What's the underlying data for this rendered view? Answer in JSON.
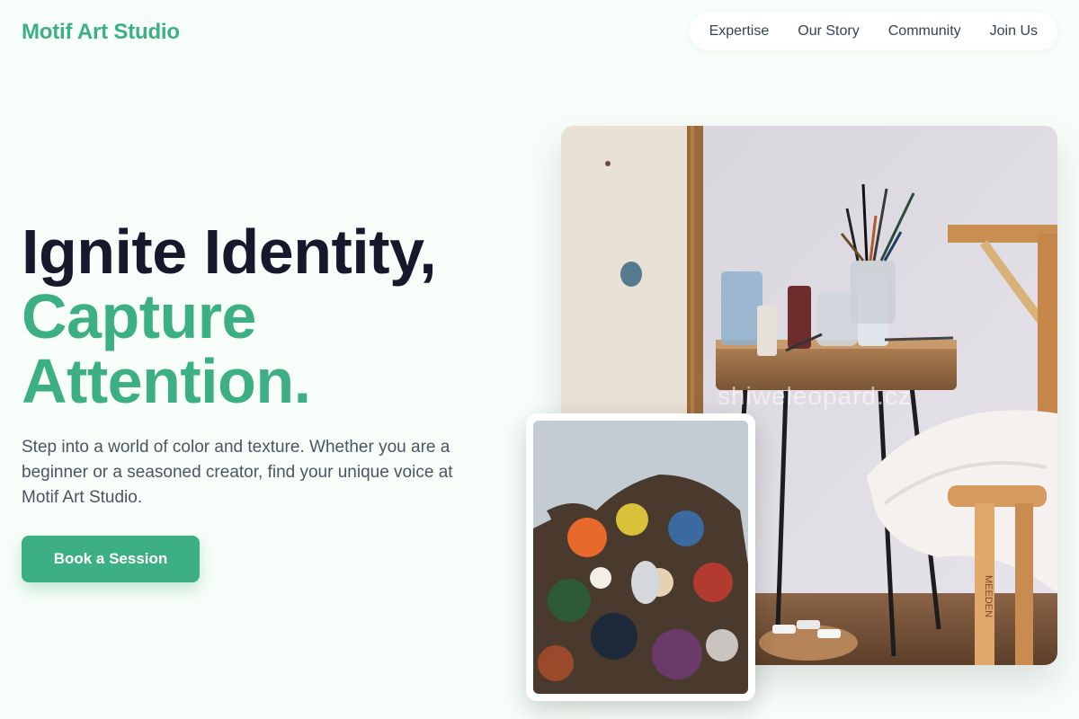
{
  "brand": {
    "name": "Motif Art Studio"
  },
  "nav": {
    "items": [
      "Expertise",
      "Our Story",
      "Community",
      "Join Us"
    ]
  },
  "hero": {
    "line1": "Ignite Identity,",
    "line2": "Capture",
    "line3": "Attention.",
    "description": "Step into a world of color and texture. Whether you are a beginner or a seasoned creator, find your unique voice at Motif Art Studio.",
    "cta_label": "Book a Session"
  },
  "images": {
    "main_watermark": "shiweleopard.cz",
    "stool_text": "MEEDEN"
  },
  "colors": {
    "accent": "#3daf85",
    "heading": "#141a2c",
    "background": "#f7fdf8"
  }
}
